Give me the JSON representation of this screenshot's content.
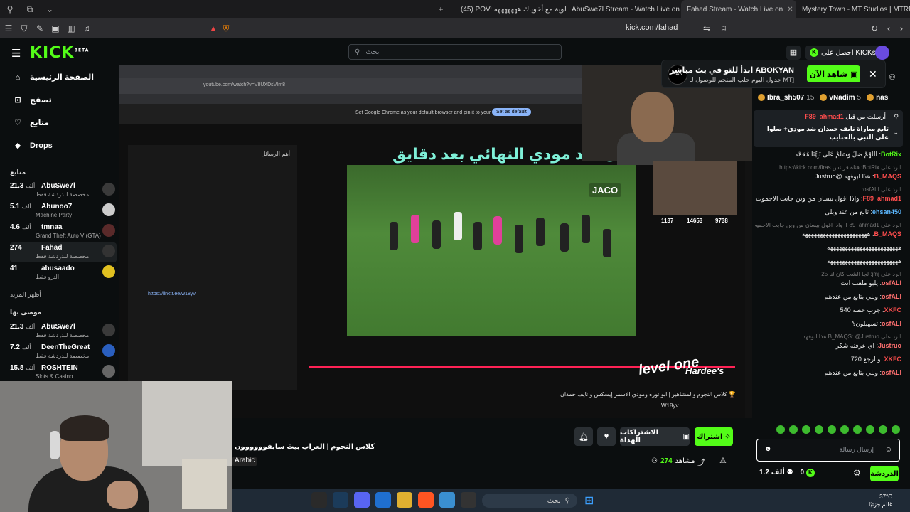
{
  "browser": {
    "tabs": [
      {
        "label": "(45) POV: طولوية مع أخوياك هههههههه",
        "color": "#ff0000"
      },
      {
        "label": "AbuSwe7l Stream - Watch Live on Ki",
        "color": "#53fc18"
      },
      {
        "label": "Fahad Stream - Watch Live on",
        "color": "#53fc18",
        "active": true
      },
      {
        "label": "Mystery Town - MT Studios | MTRP |",
        "color": "#888888"
      }
    ],
    "url": "kick.com/fahad"
  },
  "header": {
    "logo": "KICK",
    "logo_sup": "BETA",
    "search_placeholder": "بحث",
    "get_kicks": "احصل على KICKs"
  },
  "sidebar": {
    "nav": [
      {
        "label": "الصفحة الرئيسية",
        "icon": "home-icon",
        "glyph": "⌂"
      },
      {
        "label": "تصفح",
        "icon": "compass-icon",
        "glyph": "⊡"
      },
      {
        "label": "متابع",
        "icon": "heart-icon",
        "glyph": "♡"
      },
      {
        "label": "Drops",
        "icon": "drops-icon",
        "glyph": "◆"
      }
    ],
    "following_title": "متابع",
    "following": [
      {
        "name": "AbuSwe7l",
        "count": "21.3",
        "unit": "ألف",
        "sub": "مخصصة للدردشة فقط"
      },
      {
        "name": "Abunoo7",
        "count": "5.1",
        "unit": "ألف",
        "sub": "Machine Party"
      },
      {
        "name": "tmnaa",
        "count": "4.6",
        "unit": "ألف",
        "sub": "Grand Theft Auto V (GTA)"
      },
      {
        "name": "Fahad",
        "count": "274",
        "unit": "",
        "sub": "مخصصة للدردشة فقط",
        "selected": true
      },
      {
        "name": "abusaado",
        "count": "41",
        "unit": "",
        "sub": "الترو فقط"
      }
    ],
    "show_more": "أظهر المزيد",
    "recommended_title": "موصى بها",
    "recommended": [
      {
        "name": "AbuSwe7l",
        "count": "21.3",
        "unit": "ألف",
        "sub": "مخصصة للدردشة فقط"
      },
      {
        "name": "DeenTheGreat",
        "count": "7.2",
        "unit": "ألف",
        "sub": "مخصصة للدردشة فقط"
      },
      {
        "name": "ROSHTEIN",
        "count": "15.8",
        "unit": "ألف",
        "sub": "Slots & Casino"
      }
    ]
  },
  "video": {
    "headline": "دان ضد مودي النهائي بعد دقايق",
    "jaco_label": "JACO",
    "level_one": "level one",
    "hardees": "Hardee's",
    "yt_title": "كلاس النجوم والمشاهير | ابو نوره ومودي الاسمر إيسكس و نايف حمدان 🏆",
    "yt_channel": "W18yv",
    "chrome_banner": "Set Google Chrome as your default browser and pin it to your taskbar",
    "chrome_banner_btn": "Set as default",
    "yt_url": "youtube.com/watch?v=V8UXDsVIm8",
    "viewers_a": "1137",
    "viewers_b": "14653",
    "viewers_c": "9738",
    "chat_header": "أهم الرسائل",
    "chat_link": "https://linktr.ee/w18yv"
  },
  "stream": {
    "title": "كلاس النجوم | العراب بيث سابقوووووون",
    "language": "Arabic",
    "follow_label": "اشتراك",
    "subs_label": "الاشتراكات الهداة",
    "viewers": "274",
    "viewers_label": "مشاهد"
  },
  "chat": {
    "popup_title": "ابدأ للتو في بث مباشر ABOKYAN",
    "popup_sub": "جدول اليوم حلب المنجم للوصول لـ MT]",
    "popup_logo": "HAN",
    "watch_now": "شاهد الآن",
    "top_gifters": [
      {
        "name": "Ibra_sh507",
        "count": "15"
      },
      {
        "name": "vNadim",
        "count": "5"
      },
      {
        "name": "nas",
        "count": ""
      }
    ],
    "pinned_head": "أرسلت من قبل",
    "pinned_user": "F89_ahmad1",
    "pinned_msg": "تابع مباراة نايف حمدان ضد مودي+ صلوا على النبي بالحبايب",
    "messages": [
      {
        "user": "BotRix",
        "color": "#53fc18",
        "text": "اللهُمَّ صَلِّ وَسَلِّمْ عَلَى نَبِيِّنَا مُحَمَّد"
      },
      {
        "reply": true,
        "text": "الرد على BotRix: قناة فرانس https://kick.com/firas"
      },
      {
        "user": "B_MAQS",
        "color": "#ff4d4d",
        "text": "هذا ابوفهد @Justruo"
      },
      {
        "reply": true,
        "text": "الرد على osfALI:"
      },
      {
        "user": "F89_ahmad1",
        "color": "#ff4d4d",
        "text": "واذا اقول بيسان من وين جابت الاجموت"
      },
      {
        "user": "ehsan450",
        "color": "#5cb8ff",
        "text": "تابع من عند وبلي"
      },
      {
        "reply": true,
        "text": "الرد على F89_ahmad1: واذا اقول بيسان من وين جابت الاجموت"
      },
      {
        "user": "B_MAQS",
        "color": "#ff4d4d",
        "text": "ههههههههههههههههههههههه"
      },
      {
        "user": "",
        "color": "#fff",
        "text": "ههههههههههههههههههههههههه"
      },
      {
        "user": "",
        "color": "#fff",
        "text": "ههههههههههههههههههههههههه"
      },
      {
        "reply": true,
        "text": "الرد على jmj: لجا الشب كان لنا 25"
      },
      {
        "user": "osfALI",
        "color": "#ff7070",
        "text": "يلبو ملعب انت"
      },
      {
        "user": "osfALI",
        "color": "#ff7070",
        "text": "وبلي يتابع من عندهم"
      },
      {
        "user": "XKFC",
        "color": "#ff4d4d",
        "text": "جرب حطه 540"
      },
      {
        "user": "osfALI",
        "color": "#ff7070",
        "text": "تسهيلون؟"
      },
      {
        "reply": true,
        "text": "الرد على B_MAQS: @Justruo هذا ابوفهد"
      },
      {
        "user": "Justruo",
        "color": "#ff7070",
        "text": "اي عرفته شكرا"
      },
      {
        "user": "XKFC",
        "color": "#ff4d4d",
        "text": "و ارجع 720"
      },
      {
        "user": "osfALI",
        "color": "#ff7070",
        "text": "وبلي يتابع من عندهم"
      }
    ],
    "input_placeholder": "إرسال رسالة",
    "send_label": "الدردشة",
    "kicks_count": "0",
    "points": "1.2",
    "points_unit": "ألف"
  },
  "taskbar": {
    "search_placeholder": "بحث",
    "temp": "37°C",
    "weather": "غالم جزئيًا"
  }
}
